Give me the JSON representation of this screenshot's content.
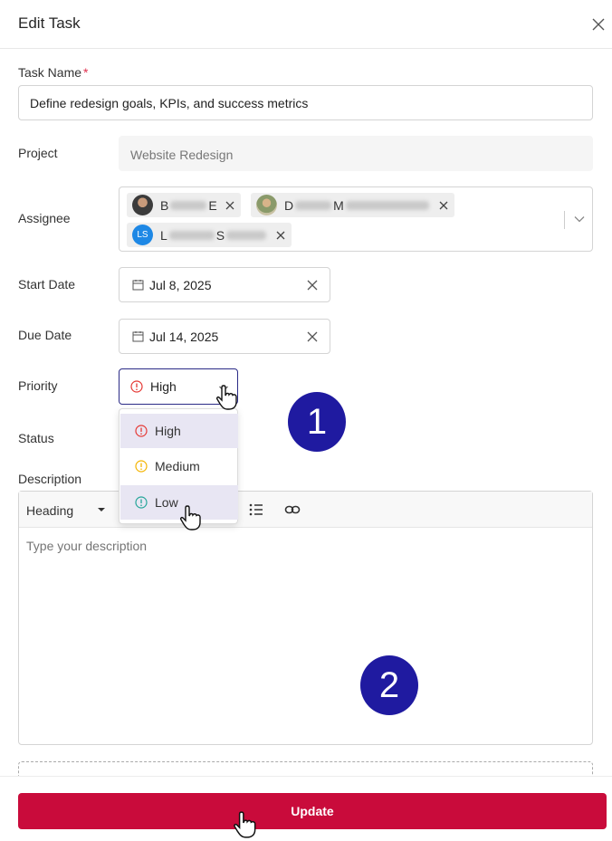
{
  "modal": {
    "title": "Edit Task"
  },
  "task_name": {
    "label": "Task Name",
    "required_mark": "*",
    "value": "Define redesign goals, KPIs, and success metrics"
  },
  "project": {
    "label": "Project",
    "value": "Website Redesign"
  },
  "assignee": {
    "label": "Assignee",
    "people": [
      {
        "first_initial": "B",
        "last_initial": "E",
        "avatar_style": "photo"
      },
      {
        "first_initial": "D",
        "last_initial": "M",
        "avatar_style": "photo"
      },
      {
        "first_initial": "L",
        "last_initial": "S",
        "avatar_initials": "LS",
        "avatar_color": "#1e88e5"
      }
    ]
  },
  "start_date": {
    "label": "Start Date",
    "value": "Jul 8, 2025"
  },
  "due_date": {
    "label": "Due Date",
    "value": "Jul 14, 2025"
  },
  "priority": {
    "label": "Priority",
    "selected": "High",
    "options": [
      {
        "label": "High",
        "color": "#e53935"
      },
      {
        "label": "Medium",
        "color": "#f4b400"
      },
      {
        "label": "Low",
        "color": "#26a69a"
      }
    ]
  },
  "status": {
    "label": "Status"
  },
  "description": {
    "label": "Description",
    "toolbar_heading": "Heading",
    "placeholder": "Type your description"
  },
  "footer": {
    "update_label": "Update",
    "accent": "#c90b3b"
  },
  "annotations": {
    "step1": "1",
    "step2": "2",
    "color": "#1f1aa0"
  }
}
